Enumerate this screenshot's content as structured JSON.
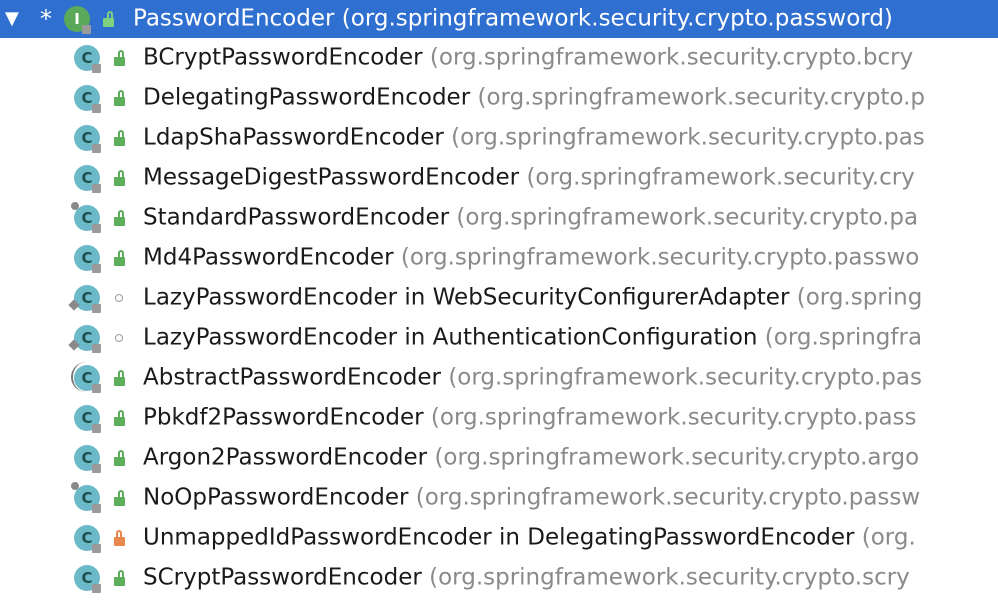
{
  "tree": {
    "root": {
      "name": "PasswordEncoder",
      "package": "(org.springframework.security.crypto.password)",
      "star": "*",
      "toggle": "▼",
      "icon_letter": "I",
      "kind": "interface",
      "expanded": true,
      "selected": true
    },
    "children": [
      {
        "name": "BCryptPasswordEncoder",
        "package": "(org.springframework.security.crypto.bcry",
        "icon_letter": "C",
        "visibility": "public"
      },
      {
        "name": "DelegatingPasswordEncoder",
        "package": "(org.springframework.security.crypto.p",
        "icon_letter": "C",
        "visibility": "public"
      },
      {
        "name": "LdapShaPasswordEncoder",
        "package": "(org.springframework.security.crypto.pas",
        "icon_letter": "C",
        "visibility": "public"
      },
      {
        "name": "MessageDigestPasswordEncoder",
        "package": "(org.springframework.security.cry",
        "icon_letter": "C",
        "visibility": "public"
      },
      {
        "name": "StandardPasswordEncoder",
        "package": "(org.springframework.security.crypto.pa",
        "icon_letter": "C",
        "visibility": "public",
        "deprecated": true
      },
      {
        "name": "Md4PasswordEncoder",
        "package": "(org.springframework.security.crypto.passwo",
        "icon_letter": "C",
        "visibility": "public"
      },
      {
        "name": "LazyPasswordEncoder in WebSecurityConfigurerAdapter",
        "package": "(org.spring",
        "icon_letter": "C",
        "visibility": "package",
        "inner": true
      },
      {
        "name": "LazyPasswordEncoder in AuthenticationConfiguration",
        "package": "(org.springfra",
        "icon_letter": "C",
        "visibility": "package",
        "inner": true
      },
      {
        "name": "AbstractPasswordEncoder",
        "package": "(org.springframework.security.crypto.pas",
        "icon_letter": "C",
        "visibility": "public",
        "abstract": true
      },
      {
        "name": "Pbkdf2PasswordEncoder",
        "package": "(org.springframework.security.crypto.pass",
        "icon_letter": "C",
        "visibility": "public"
      },
      {
        "name": "Argon2PasswordEncoder",
        "package": "(org.springframework.security.crypto.argo",
        "icon_letter": "C",
        "visibility": "public"
      },
      {
        "name": "NoOpPasswordEncoder",
        "package": "(org.springframework.security.crypto.passw",
        "icon_letter": "C",
        "visibility": "public",
        "deprecated": true
      },
      {
        "name": "UnmappedIdPasswordEncoder in DelegatingPasswordEncoder",
        "package": "(org.",
        "icon_letter": "C",
        "visibility": "private"
      },
      {
        "name": "SCryptPasswordEncoder",
        "package": "(org.springframework.security.crypto.scry",
        "icon_letter": "C",
        "visibility": "public"
      }
    ]
  },
  "colors": {
    "selection": "#2f6fd0",
    "class_icon": "#6cb9c9",
    "interface_icon": "#5aa85a",
    "public": "#5cae5c",
    "private": "#e8884c",
    "package_text": "#8a8a8a"
  }
}
